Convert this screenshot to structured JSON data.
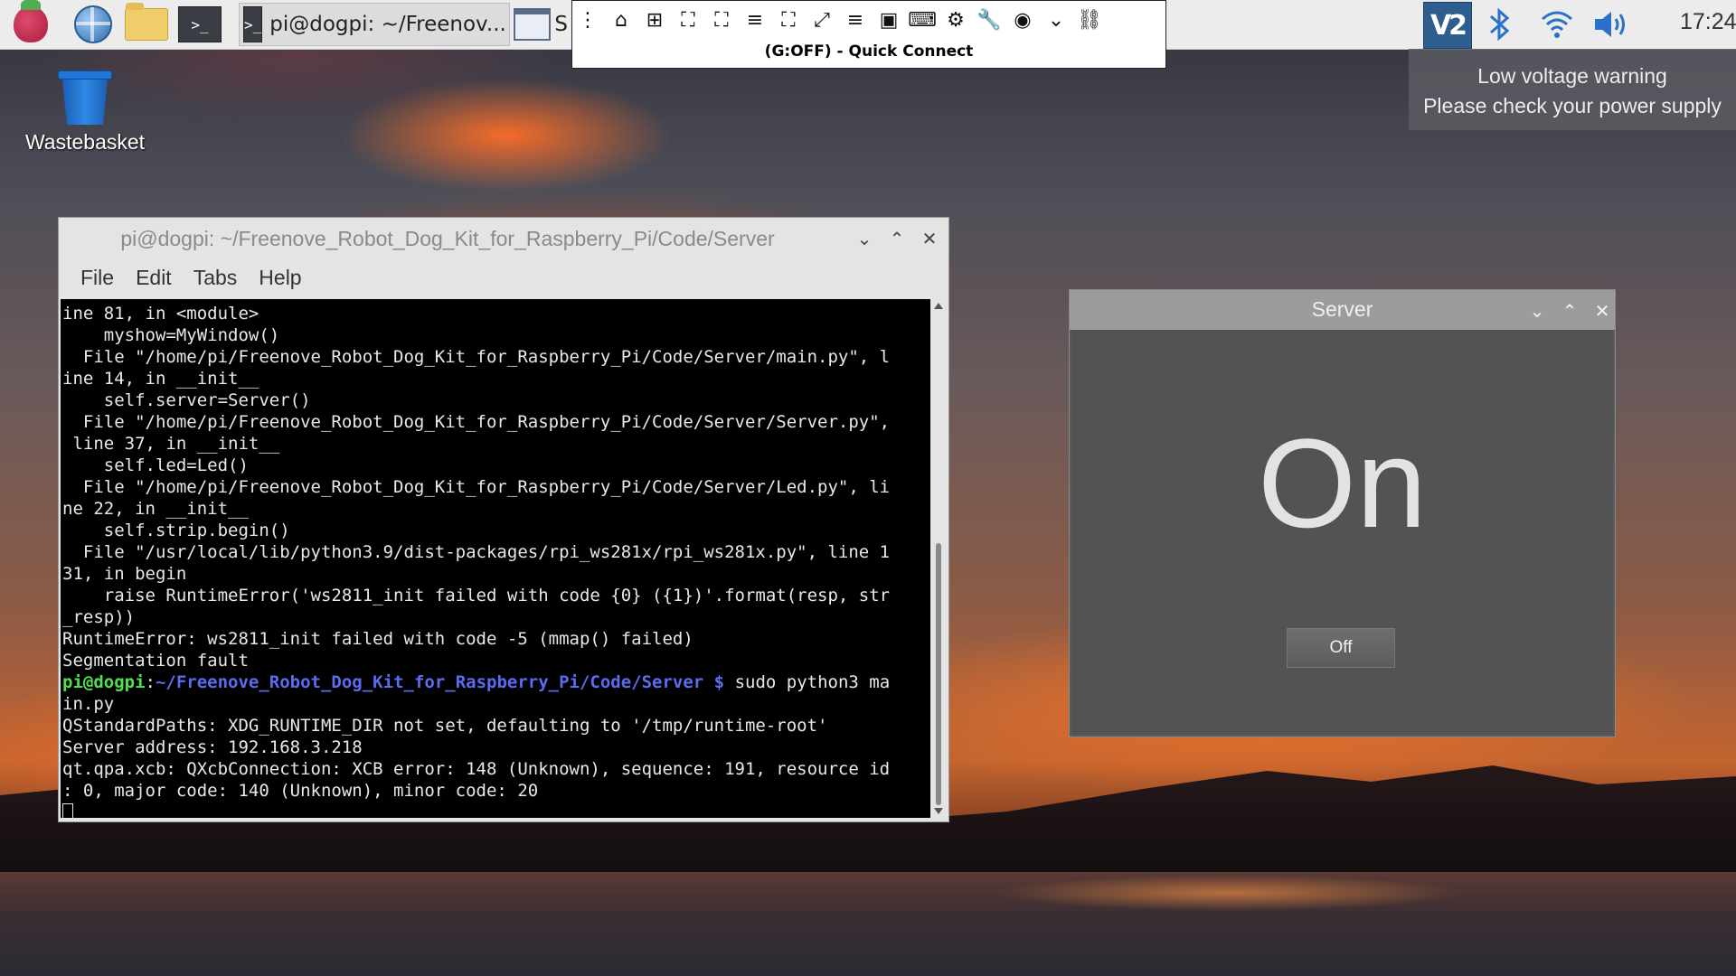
{
  "desktop": {
    "icons": [
      {
        "label": "Wastebasket",
        "icon": "wastebasket-icon"
      }
    ]
  },
  "taskbar": {
    "launchers": [
      {
        "icon": "raspberry-pi-menu-icon"
      },
      {
        "icon": "web-browser-icon"
      },
      {
        "icon": "file-manager-icon"
      },
      {
        "icon": "terminal-icon",
        "glyph": ">_"
      }
    ],
    "tasks": [
      {
        "glyph": ">_",
        "label": "pi@dogpi: ~/Freenov..."
      },
      {
        "label": "S"
      }
    ],
    "clock": "17:24",
    "tray_vnc_label": "V2"
  },
  "vnc_toolbar": {
    "title": "(G:OFF) - Quick Connect",
    "icons": [
      "menu-dots-icon",
      "home-icon",
      "new-connection-icon",
      "fit-window-icon",
      "fullscreen-icon",
      "toolbar-menu-icon",
      "scale-icon",
      "expand-icon",
      "preferences-menu-icon",
      "window-icon",
      "keyboard-icon",
      "settings-icon",
      "tools-icon",
      "screenshot-icon",
      "chevron-down-icon",
      "disconnect-icon"
    ]
  },
  "notification": {
    "line1": "Low voltage warning",
    "line2": "Please check your power supply"
  },
  "terminal": {
    "title": "pi@dogpi: ~/Freenove_Robot_Dog_Kit_for_Raspberry_Pi/Code/Server",
    "menu": [
      "File",
      "Edit",
      "Tabs",
      "Help"
    ],
    "lines": [
      "ine 81, in <module>",
      "    myshow=MyWindow()",
      "  File \"/home/pi/Freenove_Robot_Dog_Kit_for_Raspberry_Pi/Code/Server/main.py\", l",
      "ine 14, in __init__",
      "    self.server=Server()",
      "  File \"/home/pi/Freenove_Robot_Dog_Kit_for_Raspberry_Pi/Code/Server/Server.py\",",
      " line 37, in __init__",
      "    self.led=Led()",
      "  File \"/home/pi/Freenove_Robot_Dog_Kit_for_Raspberry_Pi/Code/Server/Led.py\", li",
      "ne 22, in __init__",
      "    self.strip.begin()",
      "  File \"/usr/local/lib/python3.9/dist-packages/rpi_ws281x/rpi_ws281x.py\", line 1",
      "31, in begin",
      "    raise RuntimeError('ws2811_init failed with code {0} ({1})'.format(resp, str",
      "_resp))",
      "RuntimeError: ws2811_init failed with code -5 (mmap() failed)",
      "Segmentation fault"
    ],
    "prompt_user": "pi@dogpi",
    "prompt_sep": ":",
    "prompt_path": "~/Freenove_Robot_Dog_Kit_for_Raspberry_Pi/Code/Server $",
    "prompt_cmd": " sudo python3 ma",
    "lines_after": [
      "in.py",
      "QStandardPaths: XDG_RUNTIME_DIR not set, defaulting to '/tmp/runtime-root'",
      "Server address: 192.168.3.218",
      "qt.qpa.xcb: QXcbConnection: XCB error: 148 (Unknown), sequence: 191, resource id",
      ": 0, major code: 140 (Unknown), minor code: 20"
    ]
  },
  "server_window": {
    "title": "Server",
    "state": "On",
    "button_label": "Off"
  },
  "colors": {
    "prompt_user": "#4ee04e",
    "prompt_path": "#5b6cf0",
    "tray_icon": "#2a72c8"
  }
}
